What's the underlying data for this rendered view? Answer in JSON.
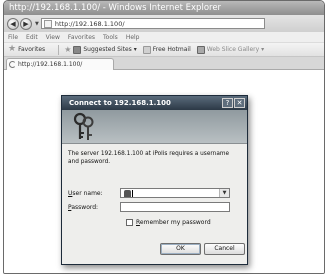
{
  "browser": {
    "title": "http://192.168.1.100/ - Windows Internet Explorer",
    "address": "http://192.168.1.100/",
    "menu": [
      "File",
      "Edit",
      "View",
      "Favorites",
      "Tools",
      "Help"
    ],
    "favorites_label": "Favorites",
    "favorites_items": [
      "Suggested Sites ▾",
      "Free Hotmail",
      "Web Slice Gallery ▾"
    ],
    "tab_label": "http://192.168.1.100/"
  },
  "dialog": {
    "title": "Connect to 192.168.1.100",
    "help_button": "?",
    "close_button": "✕",
    "message": "The server 192.168.1.100 at iPolis requires a username and password.",
    "username_label_key": "U",
    "username_label_rest": "ser name:",
    "password_label_key": "P",
    "password_label_rest": "assword:",
    "remember_key": "R",
    "remember_rest": "emember my password",
    "ok_label": "OK",
    "cancel_label": "Cancel"
  }
}
